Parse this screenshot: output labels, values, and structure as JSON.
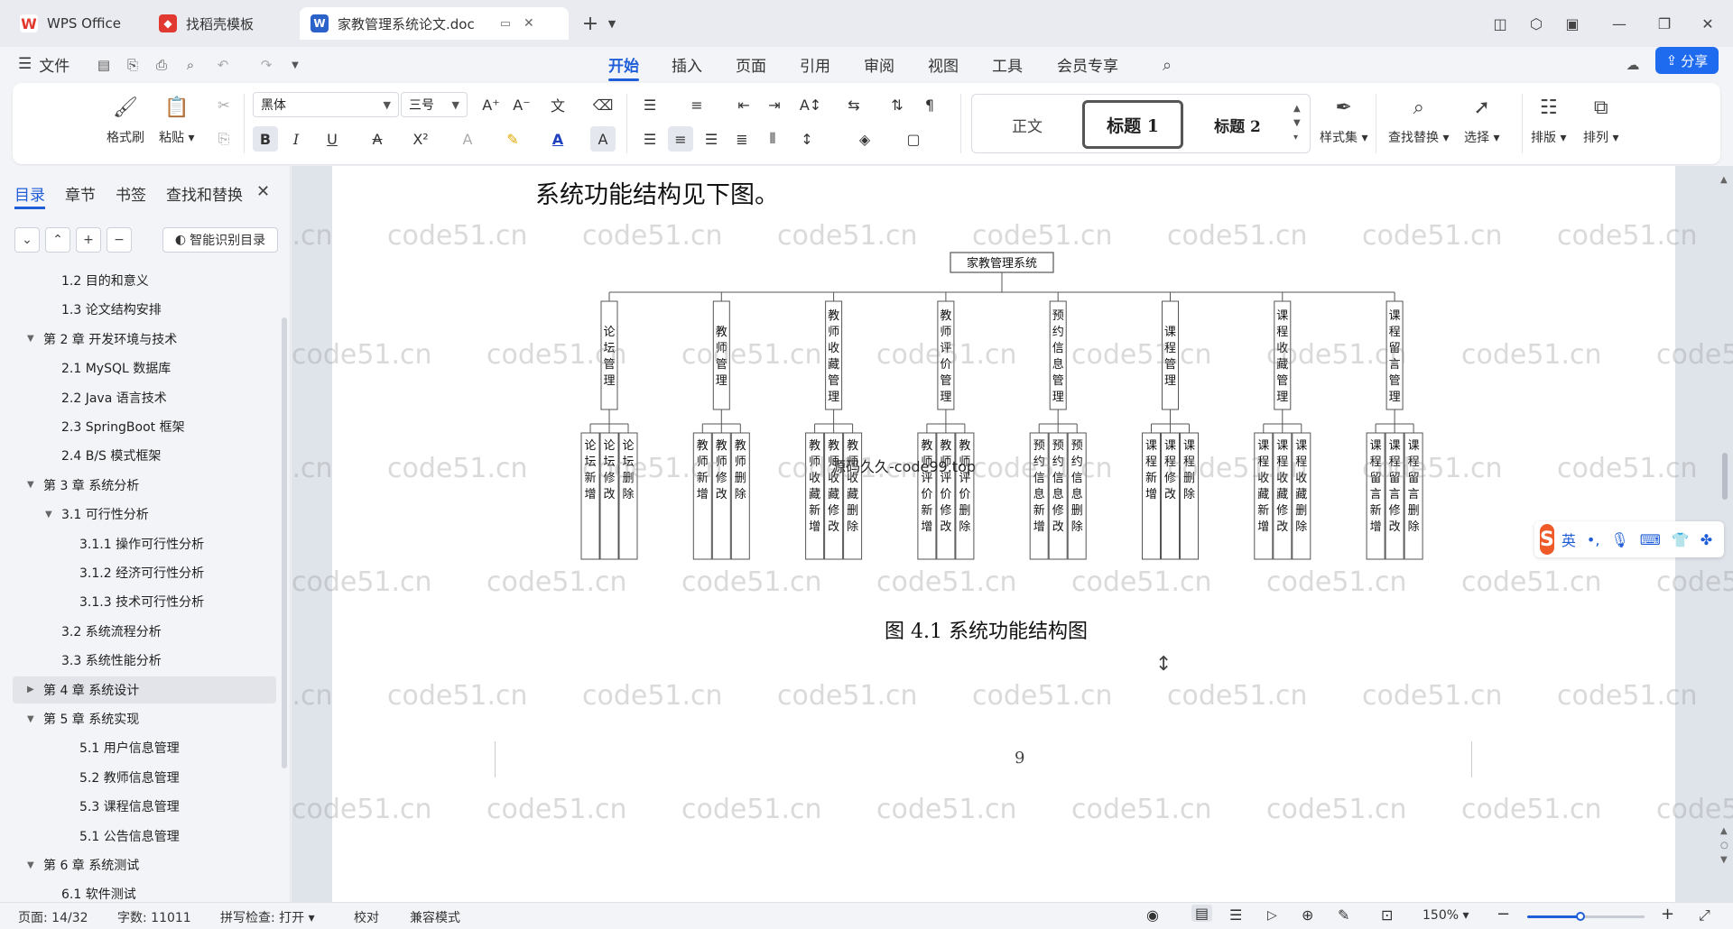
{
  "tabs": [
    {
      "label": "WPS Office",
      "icon": "wps-logo-icon",
      "color": "#e1382f"
    },
    {
      "label": "找稻壳模板",
      "icon": "docer-icon",
      "color": "#e1382f"
    },
    {
      "label": "家教管理系统论文.doc",
      "icon": "word-doc-icon",
      "color": "#2b62c9"
    }
  ],
  "menu": {
    "file_label": "文件",
    "tabs": [
      "开始",
      "插入",
      "页面",
      "引用",
      "审阅",
      "视图",
      "工具",
      "会员专享"
    ],
    "active_tab": "开始",
    "share_label": "分享"
  },
  "ribbon": {
    "format_painter": "格式刷",
    "paste": "粘贴",
    "font_name": "黑体",
    "font_size": "三号",
    "styles": [
      "正文",
      "标题 1",
      "标题 2"
    ],
    "selected_style": "标题 1",
    "style_set": "样式集",
    "find_replace": "查找替换",
    "select": "选择",
    "layout": "排版",
    "arrange": "排列",
    "bold_active": true,
    "accent_color": "#1f5ed8"
  },
  "nav": {
    "tabs": [
      "目录",
      "章节",
      "书签",
      "查找和替换"
    ],
    "active_tab": "目录",
    "smart_toc": "智能识别目录",
    "toc": [
      {
        "label": "1.2 目的和意义",
        "level": 2,
        "tri": ""
      },
      {
        "label": "1.3 论文结构安排",
        "level": 2,
        "tri": ""
      },
      {
        "label": "第 2 章  开发环境与技术",
        "level": 1,
        "tri": "down"
      },
      {
        "label": "2.1 MySQL 数据库",
        "level": 2,
        "tri": ""
      },
      {
        "label": "2.2 Java 语言技术",
        "level": 2,
        "tri": ""
      },
      {
        "label": "2.3 SpringBoot 框架",
        "level": 2,
        "tri": ""
      },
      {
        "label": "2.4 B/S 模式框架",
        "level": 2,
        "tri": ""
      },
      {
        "label": "第 3 章  系统分析",
        "level": 1,
        "tri": "down"
      },
      {
        "label": "3.1 可行性分析",
        "level": 2,
        "tri": "down"
      },
      {
        "label": "3.1.1 操作可行性分析",
        "level": 3,
        "tri": ""
      },
      {
        "label": "3.1.2 经济可行性分析",
        "level": 3,
        "tri": ""
      },
      {
        "label": "3.1.3 技术可行性分析",
        "level": 3,
        "tri": ""
      },
      {
        "label": "3.2 系统流程分析",
        "level": 2,
        "tri": ""
      },
      {
        "label": "3.3 系统性能分析",
        "level": 2,
        "tri": ""
      },
      {
        "label": "第 4 章  系统设计",
        "level": 1,
        "tri": "right",
        "highlight": true
      },
      {
        "label": "第 5 章  系统实现",
        "level": 1,
        "tri": "down"
      },
      {
        "label": "5.1 用户信息管理",
        "level": 3,
        "tri": ""
      },
      {
        "label": "5.2  教师信息管理",
        "level": 3,
        "tri": ""
      },
      {
        "label": "5.3 课程信息管理",
        "level": 3,
        "tri": ""
      },
      {
        "label": "5.1 公告信息管理",
        "level": 3,
        "tri": ""
      },
      {
        "label": "第 6 章  系统测试",
        "level": 1,
        "tri": "down"
      },
      {
        "label": "6.1 软件测试",
        "level": 2,
        "tri": ""
      }
    ]
  },
  "document": {
    "section_text": "系统功能结构见下图。",
    "caption": "图 4.1  系统功能结构图",
    "page_number": "9",
    "overlay_text": "源码久久-code99.top",
    "watermark": "code51.cn",
    "diagram": {
      "root": "家教管理系统",
      "modules": [
        {
          "name": "论坛管理",
          "children": [
            "论坛新增",
            "论坛修改",
            "论坛删除"
          ]
        },
        {
          "name": "教师管理",
          "children": [
            "教师新增",
            "教师修改",
            "教师删除"
          ]
        },
        {
          "name": "教师收藏管理",
          "children": [
            "教师收藏新增",
            "教师收藏修改",
            "教师收藏删除"
          ]
        },
        {
          "name": "教师评价管理",
          "children": [
            "教师评价新增",
            "教师评价修改",
            "教师评价删除"
          ]
        },
        {
          "name": "预约信息管理",
          "children": [
            "预约信息新增",
            "预约信息修改",
            "预约信息删除"
          ]
        },
        {
          "name": "课程管理",
          "children": [
            "课程新增",
            "课程修改",
            "课程删除"
          ]
        },
        {
          "name": "课程收藏管理",
          "children": [
            "课程收藏新增",
            "课程收藏修改",
            "课程收藏删除"
          ]
        },
        {
          "name": "课程留言管理",
          "children": [
            "课程留言新增",
            "课程留言修改",
            "课程留言删除"
          ]
        }
      ]
    }
  },
  "ime": {
    "mode": "英"
  },
  "status": {
    "page": "页面: 14/32",
    "words": "字数: 11011",
    "spell": "拼写检查: 打开",
    "proof": "校对",
    "compat": "兼容模式",
    "zoom": "150%",
    "zoom_fraction": 0.45
  }
}
